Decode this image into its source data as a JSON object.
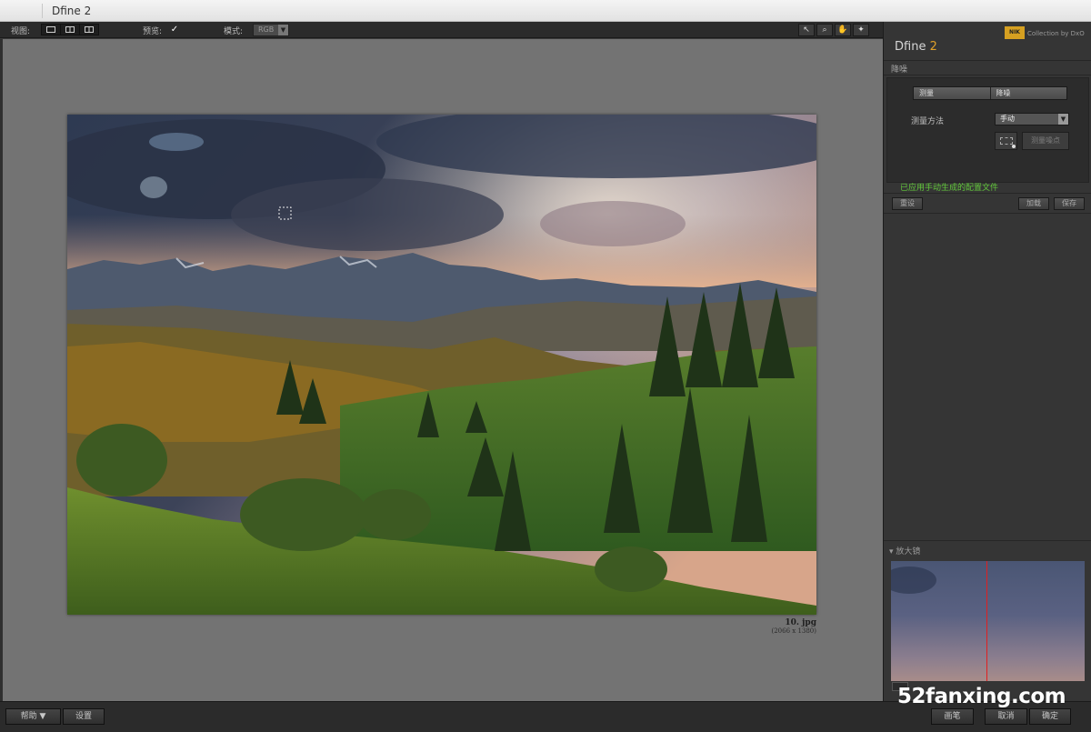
{
  "window": {
    "title": "Dfine 2"
  },
  "toolbar": {
    "view_label": "视图:",
    "preview_label": "预览:",
    "preview_checked": "✓",
    "mode_label": "模式:",
    "mode_value": "RGB",
    "tools": [
      "pointer-icon",
      "zoom-icon",
      "hand-icon",
      "loupe-icon"
    ]
  },
  "canvas": {
    "filename": "10. jpg",
    "dimensions": "(2066 x 1380)"
  },
  "panel": {
    "brand": "NIK",
    "brand_sub": "Collection by DxO",
    "app_name": "Dfine ",
    "app_version": "2",
    "section": "降噪",
    "tabs": [
      "测量",
      "降噪"
    ],
    "method_label": "测量方法",
    "method_value": "手动",
    "measure_point_btn": "测量噪点",
    "status": "已应用手动生成的配置文件",
    "reset_btn": "重设",
    "load_btn": "加载",
    "save_btn": "保存",
    "loupe_title": "放大镜"
  },
  "bottom": {
    "help_btn": "帮助",
    "settings_btn": "设置",
    "brush_btn": "画笔",
    "cancel_btn": "取消",
    "ok_btn": "确定"
  },
  "watermark": "52fanxing.com"
}
